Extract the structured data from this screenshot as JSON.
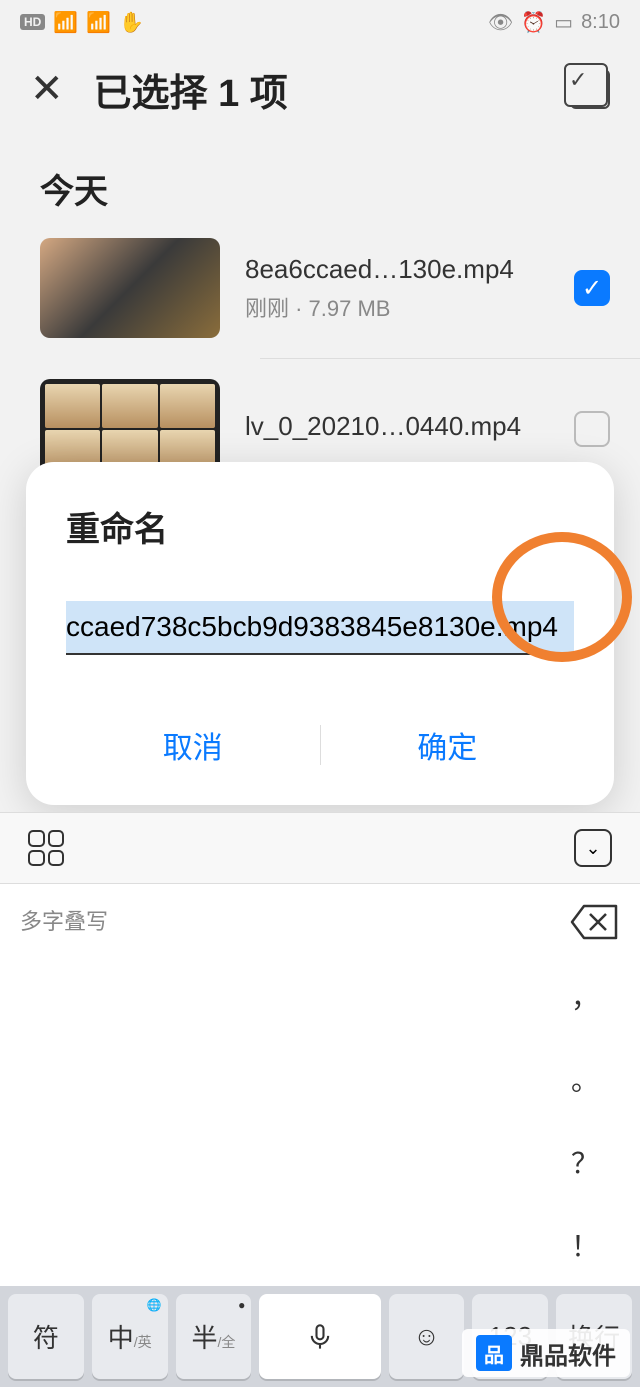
{
  "status": {
    "hd": "HD",
    "signal": "⁴⁶",
    "time": "8:10",
    "icons": "👁 ⏰ ▢▪"
  },
  "header": {
    "title": "已选择 1 项"
  },
  "section": "今天",
  "files": [
    {
      "name": "8ea6ccaed…130e.mp4",
      "meta": "刚刚 · 7.97 MB",
      "checked": true
    },
    {
      "name": "lv_0_20210…0440.mp4",
      "meta": "",
      "checked": false
    }
  ],
  "dialog": {
    "title": "重命名",
    "input_value": "ccaed738c5bcb9d9383845e8130e.mp4",
    "cancel": "取消",
    "confirm": "确定"
  },
  "keyboard": {
    "hint": "多字叠写",
    "punct": [
      "，",
      "。",
      "？",
      "！"
    ],
    "keys": {
      "sym": "符",
      "zh": "中",
      "zh_sub": "/英",
      "half": "半",
      "half_sub": "/全",
      "num": "123",
      "enter": "换行"
    }
  },
  "watermark": "鼎品软件"
}
